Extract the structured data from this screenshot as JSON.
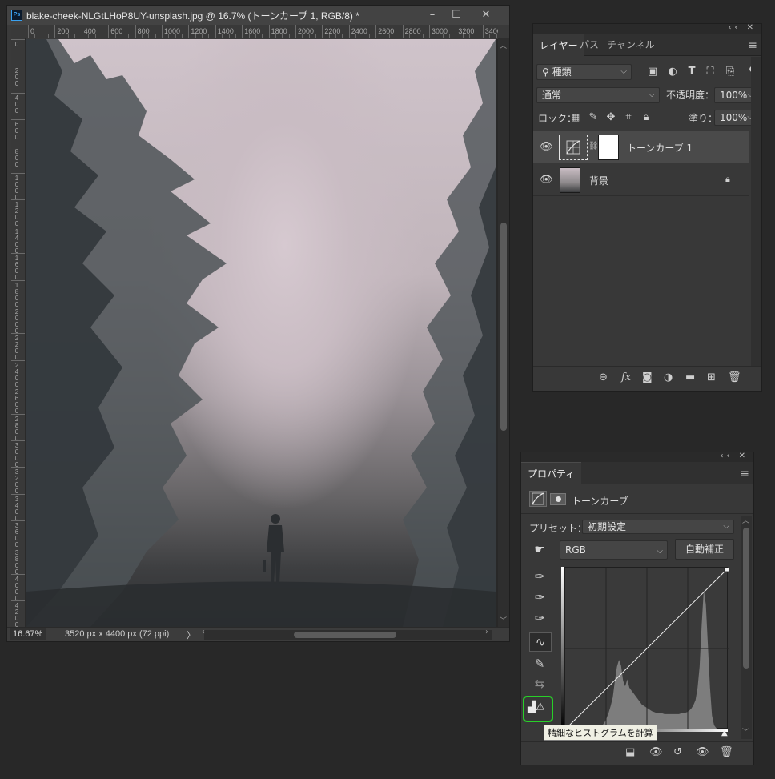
{
  "document": {
    "title": "blake-cheek-NLGtLHoP8UY-unsplash.jpg @ 16.7% (トーンカーブ 1, RGB/8) *",
    "app_badge": "Ps",
    "window_buttons": [
      "minimize-icon",
      "maximize-icon",
      "close-icon"
    ],
    "ruler_h_labels": [
      "0",
      "200",
      "400",
      "600",
      "800",
      "1000",
      "1200",
      "1400",
      "1600",
      "1800",
      "2000",
      "2200",
      "2400",
      "2600",
      "2800",
      "3000",
      "3200",
      "3400"
    ],
    "ruler_v_labels": [
      "0",
      "200",
      "400",
      "600",
      "800",
      "1000",
      "1200",
      "1400",
      "1600",
      "1800",
      "2000",
      "2200",
      "2400",
      "2600",
      "2800",
      "3000",
      "3200",
      "3400",
      "3600",
      "3800",
      "4000",
      "4200"
    ],
    "zoom": "16.67%",
    "info": "3520 px x 4400 px (72 ppi)",
    "info_arrow": "〉"
  },
  "layers_panel": {
    "tabs": [
      "レイヤー",
      "パス",
      "チャンネル"
    ],
    "filter_label": "種類",
    "blend_mode": "通常",
    "opacity_label": "不透明度：",
    "opacity_value": "100%",
    "lock_label": "ロック：",
    "fill_label": "塗り：",
    "fill_value": "100%",
    "layers": [
      {
        "name": "トーンカーブ 1",
        "type": "adjustment",
        "selected": true,
        "visible": true
      },
      {
        "name": "背景",
        "type": "background",
        "selected": false,
        "visible": true,
        "locked": true
      }
    ],
    "bottom_icons": [
      "link-icon",
      "fx-icon",
      "mask-icon",
      "adjustment-icon",
      "folder-icon",
      "new-layer-icon",
      "trash-icon"
    ]
  },
  "properties_panel": {
    "tab": "プロパティ",
    "adjustment_title": "トーンカーブ",
    "preset_label": "プリセット：",
    "preset_value": "初期設定",
    "channel": "RGB",
    "auto_button": "自動補正",
    "tooltip": "精細なヒストグラムを計算",
    "tools": [
      "on-image-adjust-icon",
      "black-eyedropper-icon",
      "gray-eyedropper-icon",
      "white-eyedropper-icon",
      "curve-point-icon",
      "pencil-icon",
      "smooth-icon",
      "histogram-warning-icon"
    ],
    "bottom_icons": [
      "clip-icon",
      "view-previous-icon",
      "reset-icon",
      "visibility-icon",
      "trash-icon"
    ],
    "curve_points": [
      [
        0,
        0
      ],
      [
        255,
        255
      ]
    ],
    "histogram": [
      0,
      0,
      0,
      0,
      0,
      0,
      0,
      0,
      0,
      0,
      0,
      0,
      0,
      0,
      0,
      0,
      2,
      4,
      6,
      10,
      16,
      24,
      34,
      46,
      70,
      90,
      100,
      92,
      70,
      62,
      72,
      60,
      56,
      52,
      48,
      44,
      40,
      36,
      34,
      32,
      30,
      28,
      26,
      25,
      24,
      24,
      23,
      23,
      22,
      22,
      22,
      22,
      22,
      22,
      22,
      22,
      23,
      23,
      24,
      25,
      27,
      30,
      35,
      42,
      60,
      90,
      150,
      200,
      180,
      120,
      60,
      20,
      6,
      2,
      0,
      0,
      0,
      0,
      0,
      0
    ]
  }
}
